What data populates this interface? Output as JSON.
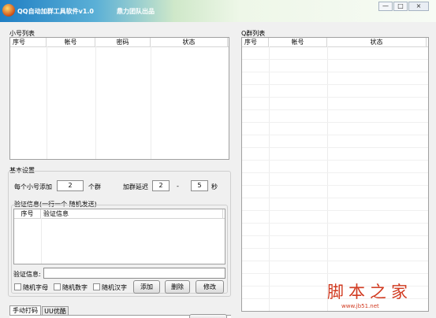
{
  "window": {
    "title": "QQ自动加群工具软件v1.0",
    "subtitle": "鼎力团队出品",
    "buttons": {
      "minimize": "—",
      "maximize": "□",
      "close": "×"
    }
  },
  "accounts_panel": {
    "label": "小号列表",
    "columns": [
      "序号",
      "帐号",
      "密码",
      "状态"
    ]
  },
  "groups_panel": {
    "label": "Q群列表",
    "columns": [
      "序号",
      "帐号",
      "状态"
    ]
  },
  "basic_settings": {
    "label": "基本设置",
    "per_account_label": "每个小号添加",
    "per_account_value": "2",
    "per_account_unit": "个群",
    "delay_label": "加群延迟",
    "delay_min": "2",
    "delay_sep": "-",
    "delay_max": "5",
    "delay_unit": "秒"
  },
  "verify": {
    "group_label": "验证信息(一行一个 随机发送)",
    "columns": [
      "序号",
      "验证信息"
    ],
    "input_label": "验证信息:",
    "input_value": "",
    "options": [
      "随机字母",
      "随机数字",
      "随机汉字"
    ],
    "buttons": {
      "add": "添加",
      "delete": "删除",
      "edit": "修改"
    }
  },
  "tabs": [
    "手动打码",
    "UU优酷"
  ],
  "watermark": {
    "brand": "脚本之家",
    "url": "www.jb51.net"
  }
}
